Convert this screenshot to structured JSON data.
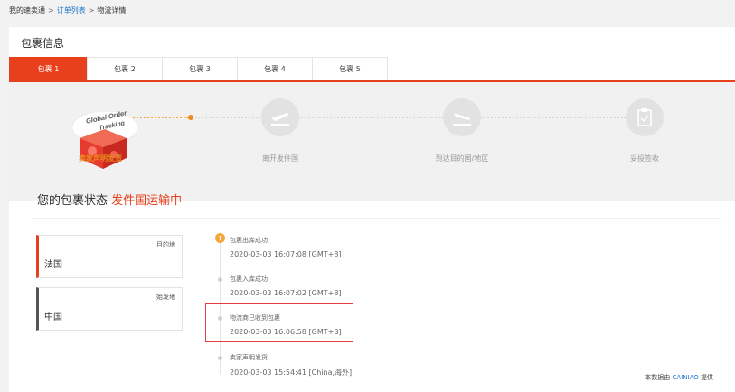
{
  "breadcrumb": {
    "home": "我的速卖通",
    "sep": ">",
    "orders": "订单列表",
    "current": "物流详情"
  },
  "panel": {
    "title": "包裹信息"
  },
  "tabs": [
    {
      "label": "包裹 1",
      "active": true
    },
    {
      "label": "包裹 2"
    },
    {
      "label": "包裹 3"
    },
    {
      "label": "包裹 4"
    },
    {
      "label": "包裹 5"
    }
  ],
  "progress": {
    "badge_text": "Global Order Tracking",
    "steps": [
      {
        "label": "卖家声明发货",
        "icon": "package-box-icon",
        "active": true
      },
      {
        "label": "离开发件国",
        "icon": "plane-takeoff-icon"
      },
      {
        "label": "到达目的国/地区",
        "icon": "plane-landing-icon"
      },
      {
        "label": "妥投签收",
        "icon": "clipboard-check-icon"
      }
    ]
  },
  "status": {
    "prefix": "您的包裹状态",
    "value": "发件国运输中"
  },
  "destination": {
    "tag": "目的地",
    "name": "法国"
  },
  "origin": {
    "tag": "始发地",
    "name": "中国"
  },
  "timeline": [
    {
      "title": "包裹出库成功",
      "time": "2020-03-03 16:07:08 [GMT+8]"
    },
    {
      "title": "包裹入库成功",
      "time": "2020-03-03 16:07:02 [GMT+8]"
    },
    {
      "title": "物流商已收到包裹",
      "time": "2020-03-03 16:06:58 [GMT+8]"
    },
    {
      "title": "卖家声明发货",
      "time": "2020-03-03 15:54:41 [China,海外]"
    }
  ],
  "source": {
    "prefix": "本数据由",
    "brand": "CAINIAO",
    "suffix": "提供"
  },
  "colors": {
    "accent": "#e8401c",
    "step_active": "#e88a1f",
    "link": "#1a73c8",
    "highlight_box": "#e43d3d"
  }
}
